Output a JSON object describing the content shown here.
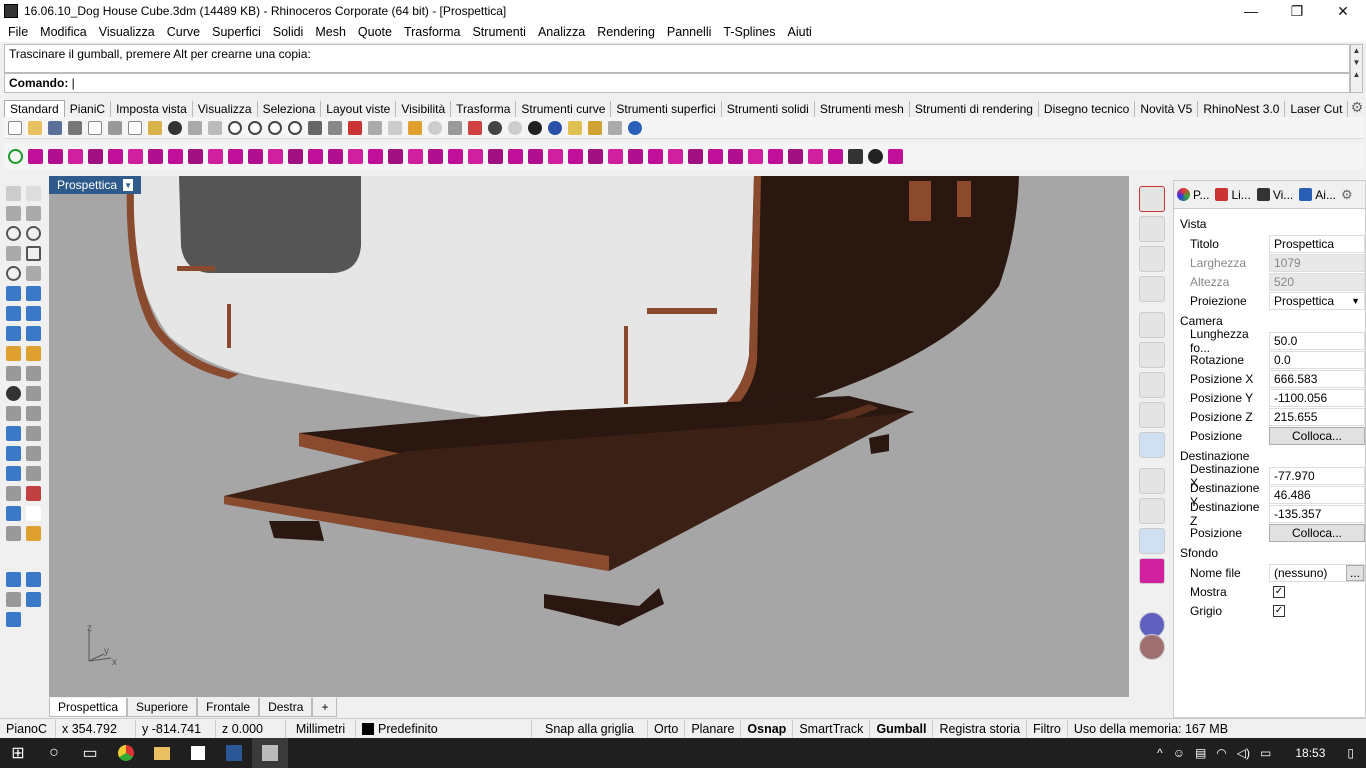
{
  "window": {
    "title": "16.06.10_Dog House Cube.3dm (14489 KB) - Rhinoceros Corporate (64 bit) - [Prospettica]",
    "minimize": "—",
    "restore": "❐",
    "close": "✕"
  },
  "menu": [
    "File",
    "Modifica",
    "Visualizza",
    "Curve",
    "Superfici",
    "Solidi",
    "Mesh",
    "Quote",
    "Trasforma",
    "Strumenti",
    "Analizza",
    "Rendering",
    "Pannelli",
    "T-Splines",
    "Aiuti"
  ],
  "command": {
    "history": "Trascinare il gumball, premere Alt per crearne una copia:",
    "prompt": "Comando:"
  },
  "toolbar_tabs": [
    "Standard",
    "PianiC",
    "Imposta vista",
    "Visualizza",
    "Seleziona",
    "Layout viste",
    "Visibilità",
    "Trasforma",
    "Strumenti curve",
    "Strumenti superfici",
    "Strumenti solidi",
    "Strumenti mesh",
    "Strumenti di rendering",
    "Disegno tecnico",
    "Novità V5",
    "RhinoNest 3.0",
    "Laser Cut"
  ],
  "viewport": {
    "label": "Prospettica",
    "axis_z": "z",
    "axis_y": "y",
    "axis_x": "x"
  },
  "view_tabs": [
    "Prospettica",
    "Superiore",
    "Frontale",
    "Destra"
  ],
  "add_view_icon": "+",
  "panel": {
    "tabs": [
      "P...",
      "Li...",
      "Vi...",
      "Ai..."
    ],
    "vista_header": "Vista",
    "vista": [
      {
        "k": "Titolo",
        "v": "Prospettica",
        "grey": false
      },
      {
        "k": "Larghezza",
        "v": "1079",
        "grey": true
      },
      {
        "k": "Altezza",
        "v": "520",
        "grey": true
      },
      {
        "k": "Proiezione",
        "v": "Prospettica",
        "grey": false
      }
    ],
    "camera_header": "Camera",
    "camera": [
      {
        "k": "Lunghezza fo...",
        "v": "50.0"
      },
      {
        "k": "Rotazione",
        "v": "0.0"
      },
      {
        "k": "Posizione X",
        "v": "666.583"
      },
      {
        "k": "Posizione Y",
        "v": "-1100.056"
      },
      {
        "k": "Posizione Z",
        "v": "215.655"
      },
      {
        "k": "Posizione",
        "v": "Colloca...",
        "button": true
      }
    ],
    "dest_header": "Destinazione",
    "dest": [
      {
        "k": "Destinazione X",
        "v": "-77.970"
      },
      {
        "k": "Destinazione Y",
        "v": "46.486"
      },
      {
        "k": "Destinazione Z",
        "v": "-135.357"
      },
      {
        "k": "Posizione",
        "v": "Colloca...",
        "button": true
      }
    ],
    "sfondo_header": "Sfondo",
    "sfondo": {
      "file_label": "Nome file",
      "file_value": "(nessuno)",
      "browse": "...",
      "mostra": "Mostra",
      "grigio": "Grigio",
      "check": "✓"
    }
  },
  "status": {
    "plane": "PianoC",
    "x": "x 354.792",
    "y": "y -814.741",
    "z": "z 0.000",
    "units": "Millimetri",
    "layer": "Predefinito",
    "snap": "Snap alla griglia",
    "orto": "Orto",
    "planare": "Planare",
    "osnap": "Osnap",
    "smarttrack": "SmartTrack",
    "gumball": "Gumball",
    "history": "Registra storia",
    "filtro": "Filtro",
    "memory": "Uso della memoria: 167 MB"
  },
  "taskbar": {
    "time": "18:53"
  },
  "colors": {
    "viewport_bg": "#a6a6a6",
    "wood": "#8a4a2e",
    "wood_dark": "#2a1710",
    "panel_white": "#e6e6e6",
    "label_blue": "#2e5a8c"
  }
}
